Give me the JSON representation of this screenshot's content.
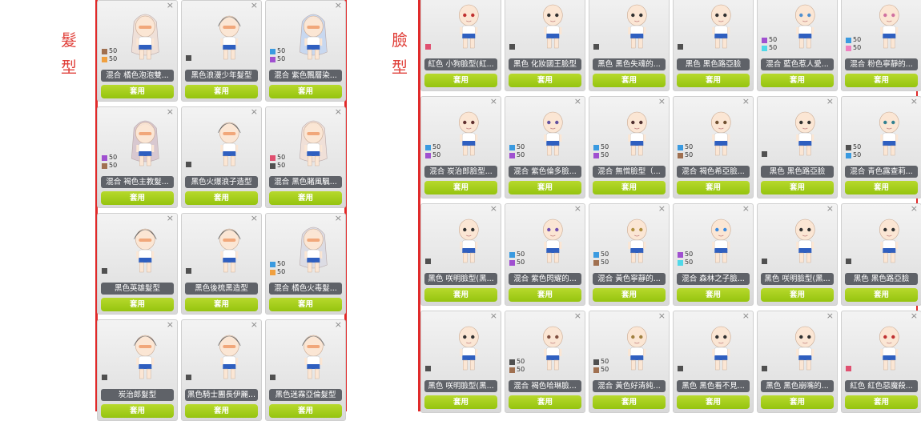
{
  "labels": {
    "hair": [
      "髮",
      "型"
    ],
    "face": [
      "臉",
      "型"
    ]
  },
  "colors": {
    "accent_red": "#e02a2a",
    "button_green": "#a6cf1e",
    "name_bar": "#5f6268"
  },
  "equip_label": "套用",
  "close_icon": "×",
  "hair": [
    {
      "name": "混合  橘色泡泡雙...",
      "stats": [
        {
          "v": "50",
          "c": "#a07050"
        },
        {
          "v": "50",
          "c": "#f0a040"
        }
      ],
      "hair": "#efe0d8",
      "long": true
    },
    {
      "name": "黑色浪漫少年髮型",
      "swatch": "#505050",
      "hair": "#dcdcdc",
      "long": false
    },
    {
      "name": "混合  紫色飄層染...",
      "stats": [
        {
          "v": "50",
          "c": "#3a9ae0"
        },
        {
          "v": "50",
          "c": "#a050d0"
        }
      ],
      "hair": "#c8d8f0",
      "long": true
    },
    {
      "name": "混合  褐色主教髮...",
      "stats": [
        {
          "v": "50",
          "c": "#a050d0"
        },
        {
          "v": "50",
          "c": "#a07050"
        }
      ],
      "hair": "#d8c8d0",
      "long": true
    },
    {
      "name": "黑色火爆浪子造型",
      "swatch": "#505050",
      "hair": "#2a2a2a",
      "long": false
    },
    {
      "name": "混合  黑色賭風颿...",
      "stats": [
        {
          "v": "50",
          "c": "#e05070"
        },
        {
          "v": "50",
          "c": "#505050"
        }
      ],
      "hair": "#f0e0d8",
      "long": true
    },
    {
      "name": "黑色英雄髮型",
      "swatch": "#505050",
      "hair": "#3a2a2a",
      "long": false
    },
    {
      "name": "黑色後梳黑造型",
      "swatch": "#505050",
      "hair": "#253a30",
      "long": false
    },
    {
      "name": "混合  橘色火毒髮...",
      "stats": [
        {
          "v": "50",
          "c": "#3a9ae0"
        },
        {
          "v": "50",
          "c": "#f0a040"
        }
      ],
      "hair": "#dcdce4",
      "long": true
    },
    {
      "name": "炭治郎髮型",
      "swatch": "#505050",
      "hair": "#7a2a20",
      "long": false
    },
    {
      "name": "黑色騎士團長伊麗...",
      "swatch": "#505050",
      "hair": "#2a2a2a",
      "long": false
    },
    {
      "name": "黑色迷霧亞倫髮型",
      "swatch": "#505050",
      "hair": "#e0e0e8",
      "long": false
    }
  ],
  "faces": [
    {
      "name": "紅色  小狗臉型(紅...",
      "swatch": "#e05070",
      "eye": "#c03030"
    },
    {
      "name": "黑色  化妝國王臉型",
      "swatch": "#505050",
      "eye": "#303030"
    },
    {
      "name": "黑色  黑色失魂的...",
      "swatch": "#505050",
      "eye": "#303030"
    },
    {
      "name": "黑色  黑色路亞臉",
      "swatch": "#505050",
      "eye": "#303030"
    },
    {
      "name": "混合  藍色惹人愛...",
      "stats": [
        {
          "v": "50",
          "c": "#a050d0"
        },
        {
          "v": "50",
          "c": "#50d8e8"
        }
      ],
      "eye": "#5090d0"
    },
    {
      "name": "混合  粉色寧靜的...",
      "stats": [
        {
          "v": "50",
          "c": "#3a9ae0"
        },
        {
          "v": "50",
          "c": "#f080c0"
        }
      ],
      "eye": "#d070a0"
    },
    {
      "name": "混合  炭治郎臉型...",
      "stats": [
        {
          "v": "50",
          "c": "#3a9ae0"
        },
        {
          "v": "50",
          "c": "#a050d0"
        }
      ],
      "eye": "#603030"
    },
    {
      "name": "混合  紫色倫多臉...",
      "stats": [
        {
          "v": "50",
          "c": "#3a9ae0"
        },
        {
          "v": "50",
          "c": "#a050d0"
        }
      ],
      "eye": "#6050a0"
    },
    {
      "name": "混合  無憎臉型（...",
      "stats": [
        {
          "v": "50",
          "c": "#3a9ae0"
        },
        {
          "v": "50",
          "c": "#a050d0"
        }
      ],
      "eye": "#503030"
    },
    {
      "name": "混合  褐色希亞臉...",
      "stats": [
        {
          "v": "50",
          "c": "#3a9ae0"
        },
        {
          "v": "50",
          "c": "#a07050"
        }
      ],
      "eye": "#705030"
    },
    {
      "name": "黑色  黑色路亞臉",
      "swatch": "#505050",
      "eye": "#303030"
    },
    {
      "name": "混合  青色露查莉...",
      "stats": [
        {
          "v": "50",
          "c": "#505050"
        },
        {
          "v": "50",
          "c": "#3a9ae0"
        }
      ],
      "eye": "#308090"
    },
    {
      "name": "黑色  咲明臉型(黑...",
      "swatch": "#505050",
      "eye": "#303030"
    },
    {
      "name": "混合  紫色閃耀的...",
      "stats": [
        {
          "v": "50",
          "c": "#3a9ae0"
        },
        {
          "v": "50",
          "c": "#a050d0"
        }
      ],
      "eye": "#7050b0"
    },
    {
      "name": "混合  黃色寧靜的...",
      "stats": [
        {
          "v": "50",
          "c": "#3a9ae0"
        },
        {
          "v": "50",
          "c": "#a07050"
        }
      ],
      "eye": "#b09040"
    },
    {
      "name": "混合  森林之子臉...",
      "stats": [
        {
          "v": "50",
          "c": "#a050d0"
        },
        {
          "v": "50",
          "c": "#50d8e8"
        }
      ],
      "eye": "#3a8ae0"
    },
    {
      "name": "黑色  咲明臉型(黑...",
      "swatch": "#505050",
      "eye": "#303030"
    },
    {
      "name": "黑色  黑色路亞臉",
      "swatch": "#505050",
      "eye": "#303030"
    },
    {
      "name": "黑色  咲明臉型(黑...",
      "swatch": "#505050",
      "eye": "#303030"
    },
    {
      "name": "混合  褐色哈琳臉...",
      "stats": [
        {
          "v": "50",
          "c": "#505050"
        },
        {
          "v": "50",
          "c": "#a07050"
        }
      ],
      "eye": "#805040"
    },
    {
      "name": "混合  黃色好清純...",
      "stats": [
        {
          "v": "50",
          "c": "#505050"
        },
        {
          "v": "50",
          "c": "#a07050"
        }
      ],
      "eye": "#a08040"
    },
    {
      "name": "黑色  黑色看不見...",
      "swatch": "#505050",
      "eye": "#303030"
    },
    {
      "name": "黑色  黑色崩嘴的...",
      "swatch": "#505050",
      "eye": "#303030"
    },
    {
      "name": "紅色  紅色惡魔殺...",
      "swatch": "#e05070",
      "eye": "#c03030"
    }
  ]
}
